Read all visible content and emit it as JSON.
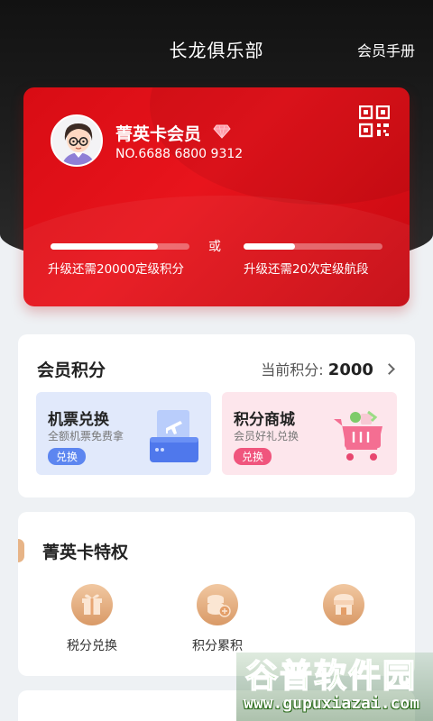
{
  "header": {
    "title": "长龙俱乐部",
    "handbook_label": "会员手册"
  },
  "card": {
    "member_level": "菁英卡会员",
    "member_no": "NO.6688 6800 9312",
    "or_text": "或",
    "progress_points_fraction": 0.77,
    "progress_points_label": "升级还需20000定级积分",
    "progress_segments_fraction": 0.37,
    "progress_segments_label": "升级还需20次定级航段",
    "icons": [
      "avatar",
      "diamond-icon",
      "qr-code-icon"
    ]
  },
  "points": {
    "title": "会员积分",
    "current_label": "当前积分:",
    "current_value": "2000",
    "promos": [
      {
        "title": "机票兑换",
        "subtitle": "全额机票免费拿",
        "tag": "兑换",
        "icon": "ticket-machine-icon"
      },
      {
        "title": "积分商城",
        "subtitle": "会员好礼兑换",
        "tag": "兑换",
        "icon": "shopping-cart-icon"
      }
    ]
  },
  "privileges": {
    "title": "菁英卡特权",
    "items": [
      {
        "label": "税分兑换",
        "icon": "gift-icon"
      },
      {
        "label": "积分累积",
        "icon": "coins-icon"
      },
      {
        "label": "",
        "icon": "lounge-icon"
      }
    ]
  },
  "watermark": {
    "logo_text": "谷普软件园",
    "url": "www.gupuxiazai.com"
  },
  "colors": {
    "card_red": "#e0101a",
    "accent_gold": "#e0a472",
    "ticket_blue": "#5d86f0",
    "mall_pink": "#f0557d"
  }
}
